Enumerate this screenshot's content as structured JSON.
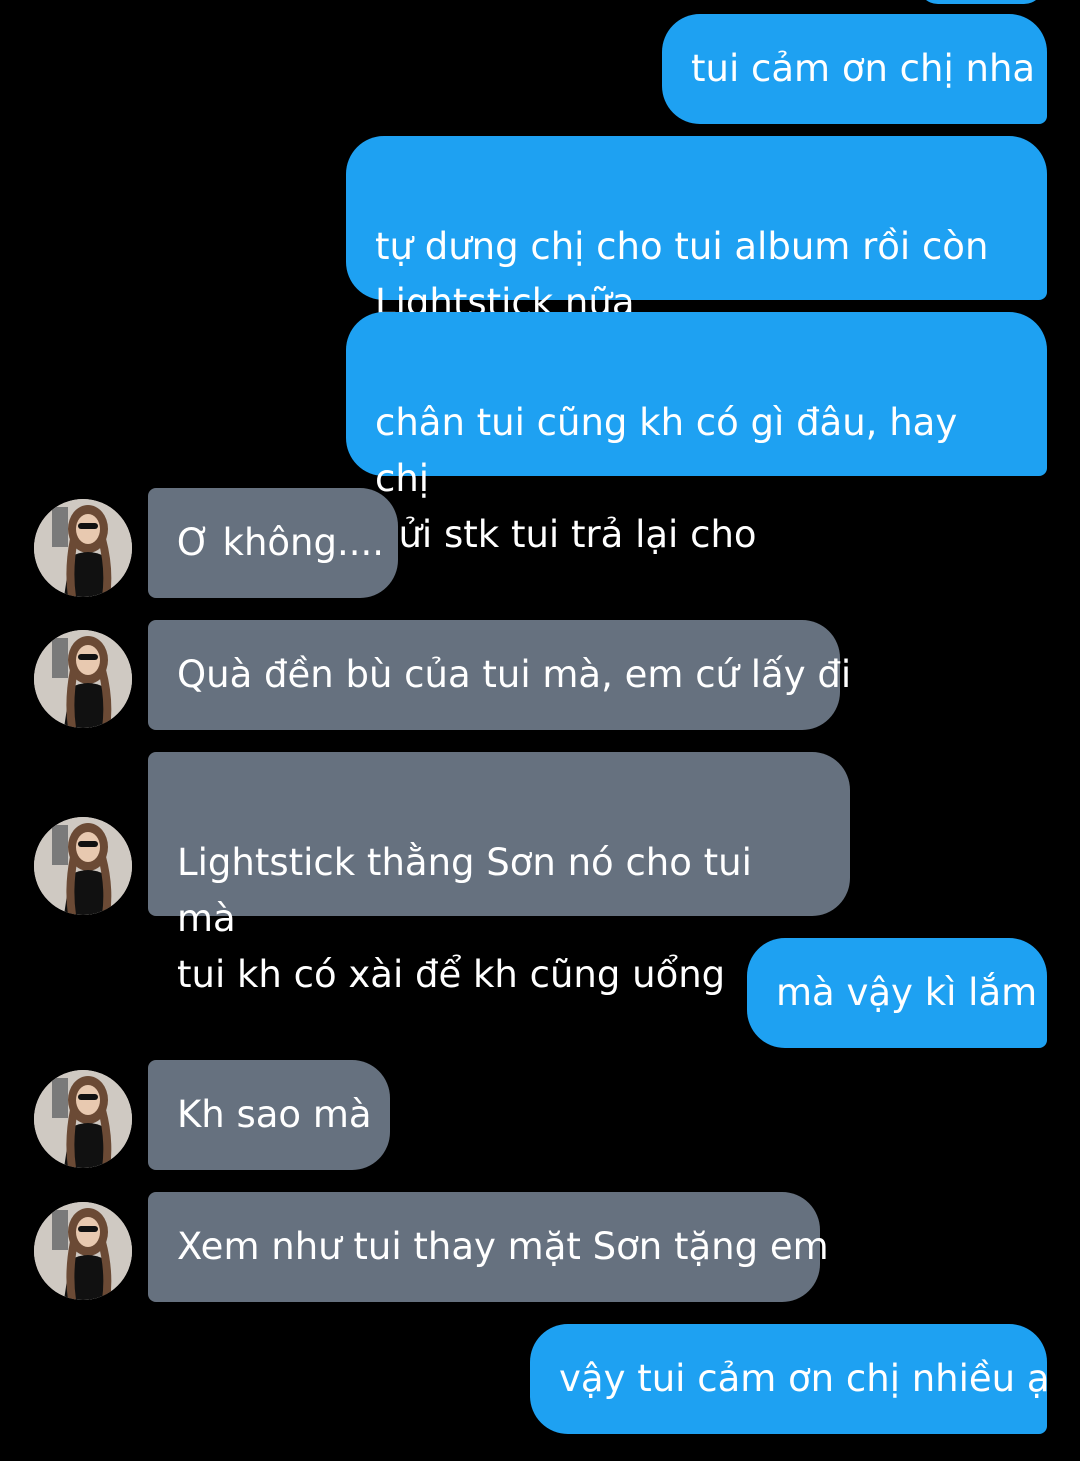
{
  "colors": {
    "background": "#000000",
    "outgoing_bubble": "#1ea1f2",
    "incoming_bubble": "#66717f",
    "text": "#ffffff"
  },
  "avatar_icon": "contact-avatar-icon",
  "messages": [
    {
      "direction": "outgoing",
      "text": "tui cảm ơn chị nha"
    },
    {
      "direction": "outgoing",
      "text": "tự dưng chị cho tui album rồi còn\nLightstick nữa"
    },
    {
      "direction": "outgoing",
      "text": "chân tui cũng kh có gì đâu, hay chị\ngửi stk tui trả lại cho"
    },
    {
      "direction": "incoming",
      "text": "Ơ không...."
    },
    {
      "direction": "incoming",
      "text": "Quà đền bù của tui mà, em cứ lấy đi"
    },
    {
      "direction": "incoming",
      "text": "Lightstick thằng Sơn nó cho tui mà\ntui kh có xài để kh cũng uổng"
    },
    {
      "direction": "outgoing",
      "text": "mà vậy kì lắm"
    },
    {
      "direction": "incoming",
      "text": "Kh sao mà"
    },
    {
      "direction": "incoming",
      "text": "Xem như tui thay mặt Sơn tặng em"
    },
    {
      "direction": "outgoing",
      "text": "vậy tui cảm ơn chị nhiều ạ"
    }
  ]
}
